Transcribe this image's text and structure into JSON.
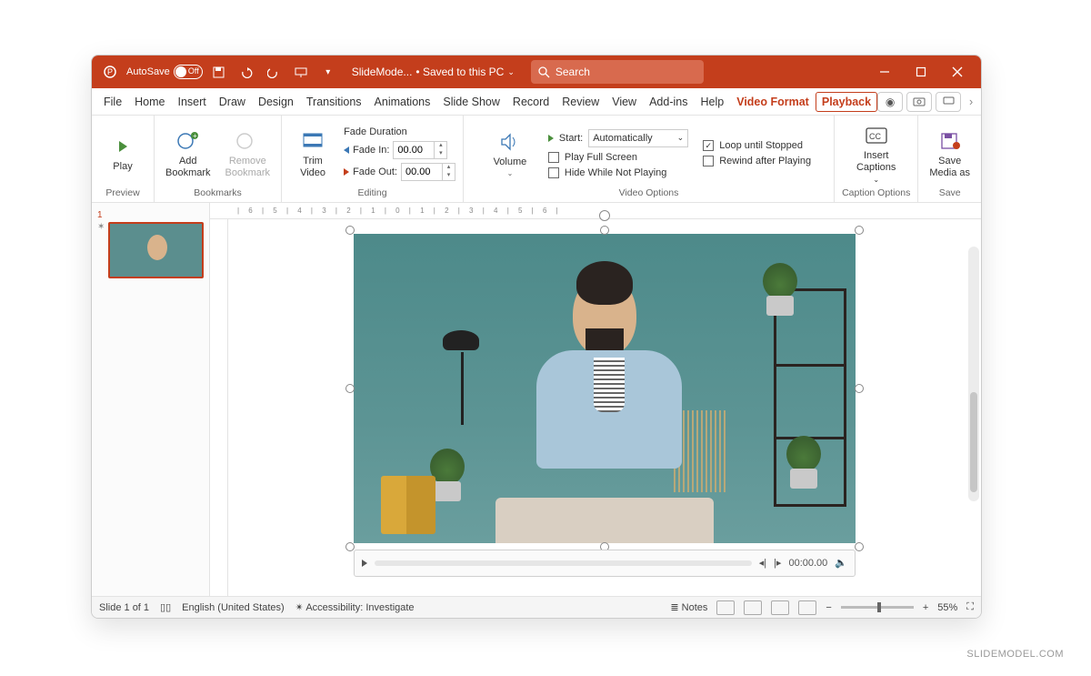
{
  "titlebar": {
    "autosave_label": "AutoSave",
    "autosave_state": "Off",
    "doc_name": "SlideMode...",
    "save_status": "• Saved to this PC",
    "search_placeholder": "Search"
  },
  "tabs": {
    "items": [
      "File",
      "Home",
      "Insert",
      "Draw",
      "Design",
      "Transitions",
      "Animations",
      "Slide Show",
      "Record",
      "Review",
      "View",
      "Add-ins",
      "Help"
    ],
    "context": [
      "Video Format",
      "Playback"
    ],
    "active": "Playback"
  },
  "ribbon": {
    "preview": {
      "play": "Play",
      "group": "Preview"
    },
    "bookmarks": {
      "add": "Add\nBookmark",
      "remove": "Remove\nBookmark",
      "group": "Bookmarks"
    },
    "editing": {
      "trim": "Trim\nVideo",
      "fade_title": "Fade Duration",
      "fade_in": "Fade In:",
      "fade_in_val": "00.00",
      "fade_out": "Fade Out:",
      "fade_out_val": "00.00",
      "group": "Editing"
    },
    "volume": "Volume",
    "video_options": {
      "start_label": "Start:",
      "start_value": "Automatically",
      "play_full": "Play Full Screen",
      "hide": "Hide While Not Playing",
      "loop": "Loop until Stopped",
      "rewind": "Rewind after Playing",
      "group": "Video Options"
    },
    "captions": {
      "insert": "Insert\nCaptions",
      "group": "Caption Options"
    },
    "save": {
      "label": "Save\nMedia as",
      "group": "Save"
    }
  },
  "thumb": {
    "num": "1"
  },
  "video_player": {
    "time": "00:00.00"
  },
  "status": {
    "slide": "Slide 1 of 1",
    "lang": "English (United States)",
    "access": "Accessibility: Investigate",
    "notes": "Notes",
    "zoom": "55%"
  },
  "watermark": "SLIDEMODEL.COM",
  "ruler": "| 6 | 5 | 4 | 3 | 2 | 1 | 0 | 1 | 2 | 3 | 4 | 5 | 6 |"
}
